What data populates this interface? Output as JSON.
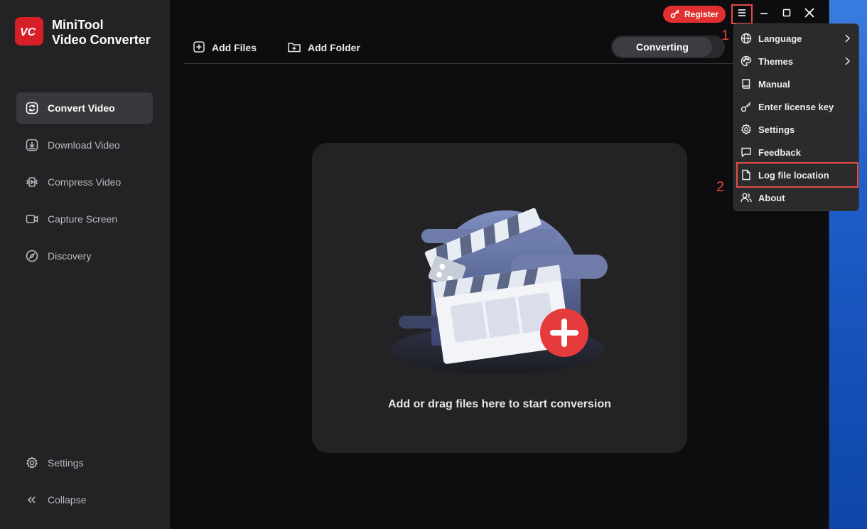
{
  "app": {
    "name_line1": "MiniTool",
    "name_line2": "Video Converter",
    "logo_text": "VC"
  },
  "sidebar": {
    "items": [
      {
        "label": "Convert Video",
        "icon": "convert-icon",
        "active": true
      },
      {
        "label": "Download Video",
        "icon": "download-icon",
        "active": false
      },
      {
        "label": "Compress Video",
        "icon": "compress-icon",
        "active": false
      },
      {
        "label": "Capture Screen",
        "icon": "camera-icon",
        "active": false
      },
      {
        "label": "Discovery",
        "icon": "compass-icon",
        "active": false
      }
    ],
    "settings_label": "Settings",
    "collapse_label": "Collapse"
  },
  "titlebar": {
    "register_label": "Register"
  },
  "toolbar": {
    "add_files_label": "Add Files",
    "add_folder_label": "Add Folder",
    "tab_converting": "Converting"
  },
  "dropzone": {
    "text": "Add or drag files here to start conversion"
  },
  "menu": {
    "items": [
      {
        "label": "Language",
        "icon": "globe-icon",
        "submenu": true
      },
      {
        "label": "Themes",
        "icon": "palette-icon",
        "submenu": true
      },
      {
        "label": "Manual",
        "icon": "book-icon",
        "submenu": false
      },
      {
        "label": "Enter license key",
        "icon": "key-icon",
        "submenu": false
      },
      {
        "label": "Settings",
        "icon": "gear-icon",
        "submenu": false
      },
      {
        "label": "Feedback",
        "icon": "chat-icon",
        "submenu": false
      },
      {
        "label": "Log file location",
        "icon": "file-icon",
        "submenu": false
      },
      {
        "label": "About",
        "icon": "people-icon",
        "submenu": false
      }
    ]
  },
  "annotations": {
    "step1": "1",
    "step2": "2"
  },
  "colors": {
    "accent_red": "#e0302f",
    "highlight_box": "#e34c47"
  }
}
